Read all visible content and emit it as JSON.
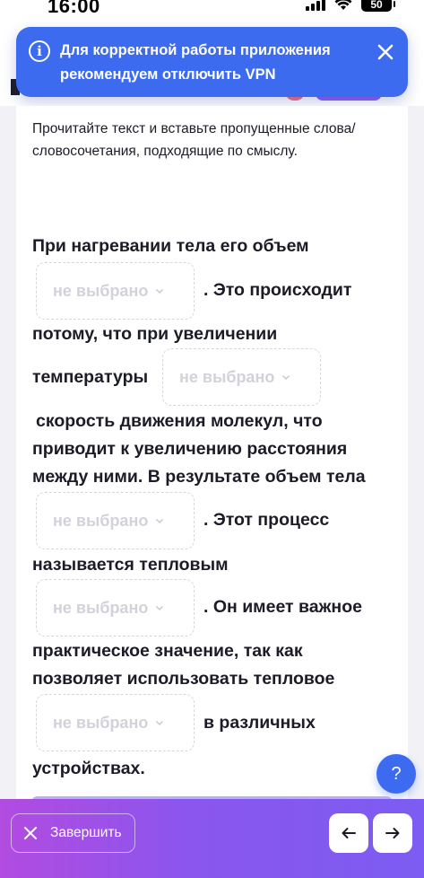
{
  "status_bar": {
    "time": "16:00",
    "battery": "50"
  },
  "toast": {
    "message": "Для корректной работы приложения рекомендуем отключить VPN"
  },
  "instruction": "Прочитайте текст и вставьте пропущенные слова/ словосочетания, подходящие по смыслу.",
  "passage": {
    "line1": "При нагревании тела его объем",
    "after_blank1": ". Это происходит",
    "line3": "потому, что при увеличении",
    "before_blank2": "температуры",
    "line5": "скорость движения молекул, что",
    "line6": "приводит к увеличению расстояния",
    "line7": "между ними. В результате объем тела",
    "after_blank3": ".   Этот процесс",
    "line9": "называется тепловым",
    "after_blank4": ". Он имеет важное",
    "line11": "практическое значение, так как",
    "line12": "позволяет использовать тепловое",
    "after_blank5": "в различных",
    "line14": "устройствах."
  },
  "blanks": [
    {
      "value": "не выбрано"
    },
    {
      "value": "не выбрано"
    },
    {
      "value": "не выбрано"
    },
    {
      "value": "не выбрано"
    },
    {
      "value": "не выбрано"
    }
  ],
  "help_button": {
    "label": "?"
  },
  "footer": {
    "finish_label": "Завершить",
    "prev_icon": "arrow-left-icon",
    "next_icon": "arrow-right-icon"
  },
  "colors": {
    "accent": "#3d6bf0",
    "footer_gradient_start": "#b24be0",
    "footer_gradient_end": "#7c5cf2"
  }
}
